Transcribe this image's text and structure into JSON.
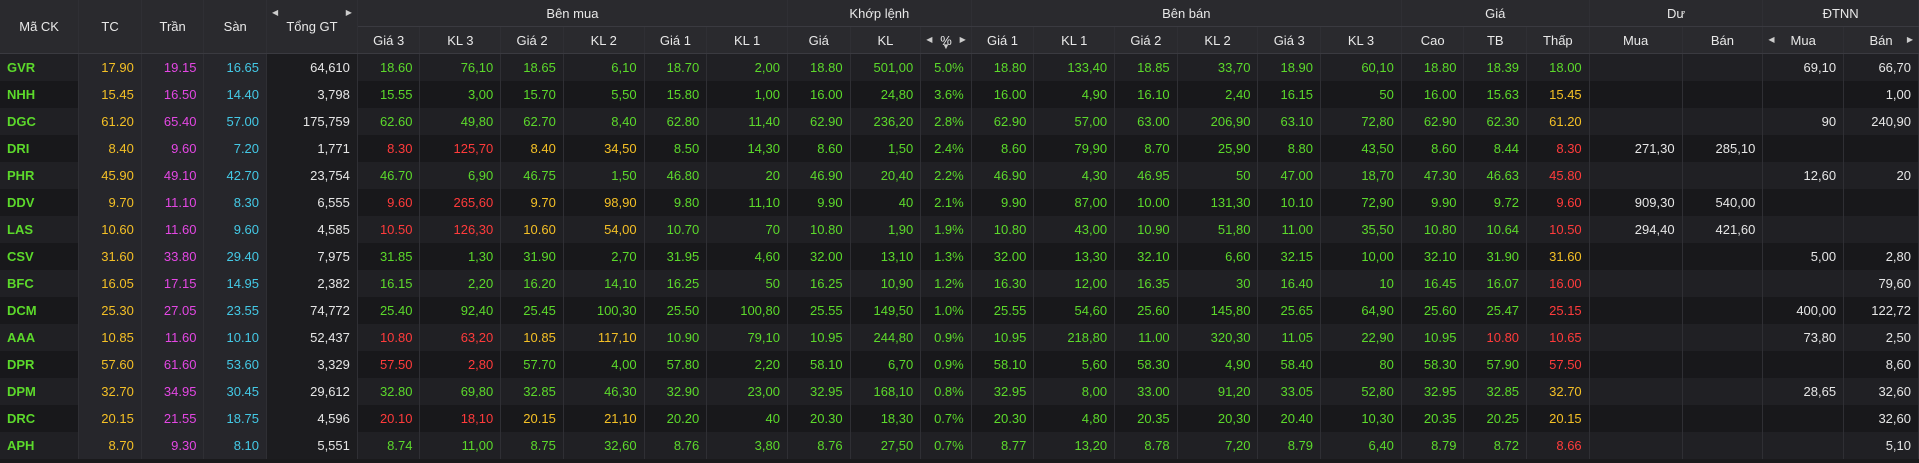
{
  "headers": {
    "symbol": "Mã CK",
    "ref": "TC",
    "ceil": "Trần",
    "floor": "Sàn",
    "total": "Tổng GT",
    "buy_group": "Bên mua",
    "match_group": "Khớp lệnh",
    "sell_group": "Bên bán",
    "price_group": "Giá",
    "resid_group": "Dư",
    "foreign_group": "ĐTNN",
    "p3": "Giá 3",
    "v3": "KL 3",
    "p2": "Giá 2",
    "v2": "KL 2",
    "p1": "Giá 1",
    "v1": "KL 1",
    "mprice": "Giá",
    "mvol": "KL",
    "mpct": "%",
    "high": "Cao",
    "avg": "TB",
    "low": "Thấp",
    "r_buy": "Mua",
    "r_sell": "Bán",
    "f_buy": "Mua",
    "f_sell": "Bán"
  },
  "colors": {
    "up": "#5cd92b",
    "down": "#ff3b3b",
    "ref": "#f4c026",
    "ceil": "#e447e4",
    "floor": "#44c9e6",
    "plain": "#e6e6e6"
  },
  "rows": [
    {
      "sym": "GVR",
      "sc": "up",
      "ref": "17.90",
      "ceil": "19.15",
      "floor": "16.65",
      "tgt": "64,610",
      "b3": "18.60",
      "b3c": "up",
      "bv3": "76,10",
      "b2": "18.65",
      "b2c": "up",
      "bv2": "6,10",
      "b1": "18.70",
      "b1c": "up",
      "bv1": "2,00",
      "mp": "18.80",
      "mc": "up",
      "mv": "501,00",
      "pct": "5.0%",
      "s1": "18.80",
      "s1c": "up",
      "sv1": "133,40",
      "s2": "18.85",
      "s2c": "up",
      "sv2": "33,70",
      "s3": "18.90",
      "s3c": "up",
      "sv3": "60,10",
      "hi": "18.80",
      "hic": "up",
      "av": "18.39",
      "avc": "up",
      "lo": "18.00",
      "loc": "up",
      "rb": "",
      "rs": "",
      "fb": "69,10",
      "fs": "66,70"
    },
    {
      "sym": "NHH",
      "sc": "up",
      "ref": "15.45",
      "ceil": "16.50",
      "floor": "14.40",
      "tgt": "3,798",
      "b3": "15.55",
      "b3c": "up",
      "bv3": "3,00",
      "b2": "15.70",
      "b2c": "up",
      "bv2": "5,50",
      "b1": "15.80",
      "b1c": "up",
      "bv1": "1,00",
      "mp": "16.00",
      "mc": "up",
      "mv": "24,80",
      "pct": "3.6%",
      "s1": "16.00",
      "s1c": "up",
      "sv1": "4,90",
      "s2": "16.10",
      "s2c": "up",
      "sv2": "2,40",
      "s3": "16.15",
      "s3c": "up",
      "sv3": "50",
      "hi": "16.00",
      "hic": "up",
      "av": "15.63",
      "avc": "up",
      "lo": "15.45",
      "loc": "ref",
      "rb": "",
      "rs": "",
      "fb": "",
      "fs": "1,00"
    },
    {
      "sym": "DGC",
      "sc": "up",
      "ref": "61.20",
      "ceil": "65.40",
      "floor": "57.00",
      "tgt": "175,759",
      "b3": "62.60",
      "b3c": "up",
      "bv3": "49,80",
      "b2": "62.70",
      "b2c": "up",
      "bv2": "8,40",
      "b1": "62.80",
      "b1c": "up",
      "bv1": "11,40",
      "mp": "62.90",
      "mc": "up",
      "mv": "236,20",
      "pct": "2.8%",
      "s1": "62.90",
      "s1c": "up",
      "sv1": "57,00",
      "s2": "63.00",
      "s2c": "up",
      "sv2": "206,90",
      "s3": "63.10",
      "s3c": "up",
      "sv3": "72,80",
      "hi": "62.90",
      "hic": "up",
      "av": "62.30",
      "avc": "up",
      "lo": "61.20",
      "loc": "ref",
      "rb": "",
      "rs": "",
      "fb": "90",
      "fs": "240,90"
    },
    {
      "sym": "DRI",
      "sc": "up",
      "ref": "8.40",
      "ceil": "9.60",
      "floor": "7.20",
      "tgt": "1,771",
      "b3": "8.30",
      "b3c": "down",
      "bv3": "125,70",
      "b2": "8.40",
      "b2c": "ref",
      "bv2": "34,50",
      "b1": "8.50",
      "b1c": "up",
      "bv1": "14,30",
      "mp": "8.60",
      "mc": "up",
      "mv": "1,50",
      "pct": "2.4%",
      "s1": "8.60",
      "s1c": "up",
      "sv1": "79,90",
      "s2": "8.70",
      "s2c": "up",
      "sv2": "25,90",
      "s3": "8.80",
      "s3c": "up",
      "sv3": "43,50",
      "hi": "8.60",
      "hic": "up",
      "av": "8.44",
      "avc": "up",
      "lo": "8.30",
      "loc": "down",
      "rb": "271,30",
      "rs": "285,10",
      "fb": "",
      "fs": ""
    },
    {
      "sym": "PHR",
      "sc": "up",
      "ref": "45.90",
      "ceil": "49.10",
      "floor": "42.70",
      "tgt": "23,754",
      "b3": "46.70",
      "b3c": "up",
      "bv3": "6,90",
      "b2": "46.75",
      "b2c": "up",
      "bv2": "1,50",
      "b1": "46.80",
      "b1c": "up",
      "bv1": "20",
      "mp": "46.90",
      "mc": "up",
      "mv": "20,40",
      "pct": "2.2%",
      "s1": "46.90",
      "s1c": "up",
      "sv1": "4,30",
      "s2": "46.95",
      "s2c": "up",
      "sv2": "50",
      "s3": "47.00",
      "s3c": "up",
      "sv3": "18,70",
      "hi": "47.30",
      "hic": "up",
      "av": "46.63",
      "avc": "up",
      "lo": "45.80",
      "loc": "down",
      "rb": "",
      "rs": "",
      "fb": "12,60",
      "fs": "20"
    },
    {
      "sym": "DDV",
      "sc": "up",
      "ref": "9.70",
      "ceil": "11.10",
      "floor": "8.30",
      "tgt": "6,555",
      "b3": "9.60",
      "b3c": "down",
      "bv3": "265,60",
      "b2": "9.70",
      "b2c": "ref",
      "bv2": "98,90",
      "b1": "9.80",
      "b1c": "up",
      "bv1": "11,10",
      "mp": "9.90",
      "mc": "up",
      "mv": "40",
      "pct": "2.1%",
      "s1": "9.90",
      "s1c": "up",
      "sv1": "87,00",
      "s2": "10.00",
      "s2c": "up",
      "sv2": "131,30",
      "s3": "10.10",
      "s3c": "up",
      "sv3": "72,90",
      "hi": "9.90",
      "hic": "up",
      "av": "9.72",
      "avc": "up",
      "lo": "9.60",
      "loc": "down",
      "rb": "909,30",
      "rs": "540,00",
      "fb": "",
      "fs": ""
    },
    {
      "sym": "LAS",
      "sc": "up",
      "ref": "10.60",
      "ceil": "11.60",
      "floor": "9.60",
      "tgt": "4,585",
      "b3": "10.50",
      "b3c": "down",
      "bv3": "126,30",
      "b2": "10.60",
      "b2c": "ref",
      "bv2": "54,00",
      "b1": "10.70",
      "b1c": "up",
      "bv1": "70",
      "mp": "10.80",
      "mc": "up",
      "mv": "1,90",
      "pct": "1.9%",
      "s1": "10.80",
      "s1c": "up",
      "sv1": "43,00",
      "s2": "10.90",
      "s2c": "up",
      "sv2": "51,80",
      "s3": "11.00",
      "s3c": "up",
      "sv3": "35,50",
      "hi": "10.80",
      "hic": "up",
      "av": "10.64",
      "avc": "up",
      "lo": "10.50",
      "loc": "down",
      "rb": "294,40",
      "rs": "421,60",
      "fb": "",
      "fs": ""
    },
    {
      "sym": "CSV",
      "sc": "up",
      "ref": "31.60",
      "ceil": "33.80",
      "floor": "29.40",
      "tgt": "7,975",
      "b3": "31.85",
      "b3c": "up",
      "bv3": "1,30",
      "b2": "31.90",
      "b2c": "up",
      "bv2": "2,70",
      "b1": "31.95",
      "b1c": "up",
      "bv1": "4,60",
      "mp": "32.00",
      "mc": "up",
      "mv": "13,10",
      "pct": "1.3%",
      "s1": "32.00",
      "s1c": "up",
      "sv1": "13,30",
      "s2": "32.10",
      "s2c": "up",
      "sv2": "6,60",
      "s3": "32.15",
      "s3c": "up",
      "sv3": "10,00",
      "hi": "32.10",
      "hic": "up",
      "av": "31.90",
      "avc": "up",
      "lo": "31.60",
      "loc": "ref",
      "rb": "",
      "rs": "",
      "fb": "5,00",
      "fs": "2,80"
    },
    {
      "sym": "BFC",
      "sc": "up",
      "ref": "16.05",
      "ceil": "17.15",
      "floor": "14.95",
      "tgt": "2,382",
      "b3": "16.15",
      "b3c": "up",
      "bv3": "2,20",
      "b2": "16.20",
      "b2c": "up",
      "bv2": "14,10",
      "b1": "16.25",
      "b1c": "up",
      "bv1": "50",
      "mp": "16.25",
      "mc": "up",
      "mv": "10,90",
      "pct": "1.2%",
      "s1": "16.30",
      "s1c": "up",
      "sv1": "12,00",
      "s2": "16.35",
      "s2c": "up",
      "sv2": "30",
      "s3": "16.40",
      "s3c": "up",
      "sv3": "10",
      "hi": "16.45",
      "hic": "up",
      "av": "16.07",
      "avc": "up",
      "lo": "16.00",
      "loc": "down",
      "rb": "",
      "rs": "",
      "fb": "",
      "fs": "79,60"
    },
    {
      "sym": "DCM",
      "sc": "up",
      "ref": "25.30",
      "ceil": "27.05",
      "floor": "23.55",
      "tgt": "74,772",
      "b3": "25.40",
      "b3c": "up",
      "bv3": "92,40",
      "b2": "25.45",
      "b2c": "up",
      "bv2": "100,30",
      "b1": "25.50",
      "b1c": "up",
      "bv1": "100,80",
      "mp": "25.55",
      "mc": "up",
      "mv": "149,50",
      "pct": "1.0%",
      "s1": "25.55",
      "s1c": "up",
      "sv1": "54,60",
      "s2": "25.60",
      "s2c": "up",
      "sv2": "145,80",
      "s3": "25.65",
      "s3c": "up",
      "sv3": "64,90",
      "hi": "25.60",
      "hic": "up",
      "av": "25.47",
      "avc": "up",
      "lo": "25.15",
      "loc": "down",
      "rb": "",
      "rs": "",
      "fb": "400,00",
      "fs": "122,72"
    },
    {
      "sym": "AAA",
      "sc": "up",
      "ref": "10.85",
      "ceil": "11.60",
      "floor": "10.10",
      "tgt": "52,437",
      "b3": "10.80",
      "b3c": "down",
      "bv3": "63,20",
      "b2": "10.85",
      "b2c": "ref",
      "bv2": "117,10",
      "b1": "10.90",
      "b1c": "up",
      "bv1": "79,10",
      "mp": "10.95",
      "mc": "up",
      "mv": "244,80",
      "pct": "0.9%",
      "s1": "10.95",
      "s1c": "up",
      "sv1": "218,80",
      "s2": "11.00",
      "s2c": "up",
      "sv2": "320,30",
      "s3": "11.05",
      "s3c": "up",
      "sv3": "22,90",
      "hi": "10.95",
      "hic": "up",
      "av": "10.80",
      "avc": "down",
      "lo": "10.65",
      "loc": "down",
      "rb": "",
      "rs": "",
      "fb": "73,80",
      "fs": "2,50"
    },
    {
      "sym": "DPR",
      "sc": "up",
      "ref": "57.60",
      "ceil": "61.60",
      "floor": "53.60",
      "tgt": "3,329",
      "b3": "57.50",
      "b3c": "down",
      "bv3": "2,80",
      "b2": "57.70",
      "b2c": "up",
      "bv2": "4,00",
      "b1": "57.80",
      "b1c": "up",
      "bv1": "2,20",
      "mp": "58.10",
      "mc": "up",
      "mv": "6,70",
      "pct": "0.9%",
      "s1": "58.10",
      "s1c": "up",
      "sv1": "5,60",
      "s2": "58.30",
      "s2c": "up",
      "sv2": "4,90",
      "s3": "58.40",
      "s3c": "up",
      "sv3": "80",
      "hi": "58.30",
      "hic": "up",
      "av": "57.90",
      "avc": "up",
      "lo": "57.50",
      "loc": "down",
      "rb": "",
      "rs": "",
      "fb": "",
      "fs": "8,60"
    },
    {
      "sym": "DPM",
      "sc": "up",
      "ref": "32.70",
      "ceil": "34.95",
      "floor": "30.45",
      "tgt": "29,612",
      "b3": "32.80",
      "b3c": "up",
      "bv3": "69,80",
      "b2": "32.85",
      "b2c": "up",
      "bv2": "46,30",
      "b1": "32.90",
      "b1c": "up",
      "bv1": "23,00",
      "mp": "32.95",
      "mc": "up",
      "mv": "168,10",
      "pct": "0.8%",
      "s1": "32.95",
      "s1c": "up",
      "sv1": "8,00",
      "s2": "33.00",
      "s2c": "up",
      "sv2": "91,20",
      "s3": "33.05",
      "s3c": "up",
      "sv3": "52,80",
      "hi": "32.95",
      "hic": "up",
      "av": "32.85",
      "avc": "up",
      "lo": "32.70",
      "loc": "ref",
      "rb": "",
      "rs": "",
      "fb": "28,65",
      "fs": "32,60"
    },
    {
      "sym": "DRC",
      "sc": "up",
      "ref": "20.15",
      "ceil": "21.55",
      "floor": "18.75",
      "tgt": "4,596",
      "b3": "20.10",
      "b3c": "down",
      "bv3": "18,10",
      "b2": "20.15",
      "b2c": "ref",
      "bv2": "21,10",
      "b1": "20.20",
      "b1c": "up",
      "bv1": "40",
      "mp": "20.30",
      "mc": "up",
      "mv": "18,30",
      "pct": "0.7%",
      "s1": "20.30",
      "s1c": "up",
      "sv1": "4,80",
      "s2": "20.35",
      "s2c": "up",
      "sv2": "20,30",
      "s3": "20.40",
      "s3c": "up",
      "sv3": "10,30",
      "hi": "20.35",
      "hic": "up",
      "av": "20.25",
      "avc": "up",
      "lo": "20.15",
      "loc": "ref",
      "rb": "",
      "rs": "",
      "fb": "",
      "fs": "32,60"
    },
    {
      "sym": "APH",
      "sc": "up",
      "ref": "8.70",
      "ceil": "9.30",
      "floor": "8.10",
      "tgt": "5,551",
      "b3": "8.74",
      "b3c": "up",
      "bv3": "11,00",
      "b2": "8.75",
      "b2c": "up",
      "bv2": "32,60",
      "b1": "8.76",
      "b1c": "up",
      "bv1": "3,80",
      "mp": "8.76",
      "mc": "up",
      "mv": "27,50",
      "pct": "0.7%",
      "s1": "8.77",
      "s1c": "up",
      "sv1": "13,20",
      "s2": "8.78",
      "s2c": "up",
      "sv2": "7,20",
      "s3": "8.79",
      "s3c": "up",
      "sv3": "6,40",
      "hi": "8.79",
      "hic": "up",
      "av": "8.72",
      "avc": "up",
      "lo": "8.66",
      "loc": "down",
      "rb": "",
      "rs": "",
      "fb": "",
      "fs": "5,10"
    }
  ]
}
